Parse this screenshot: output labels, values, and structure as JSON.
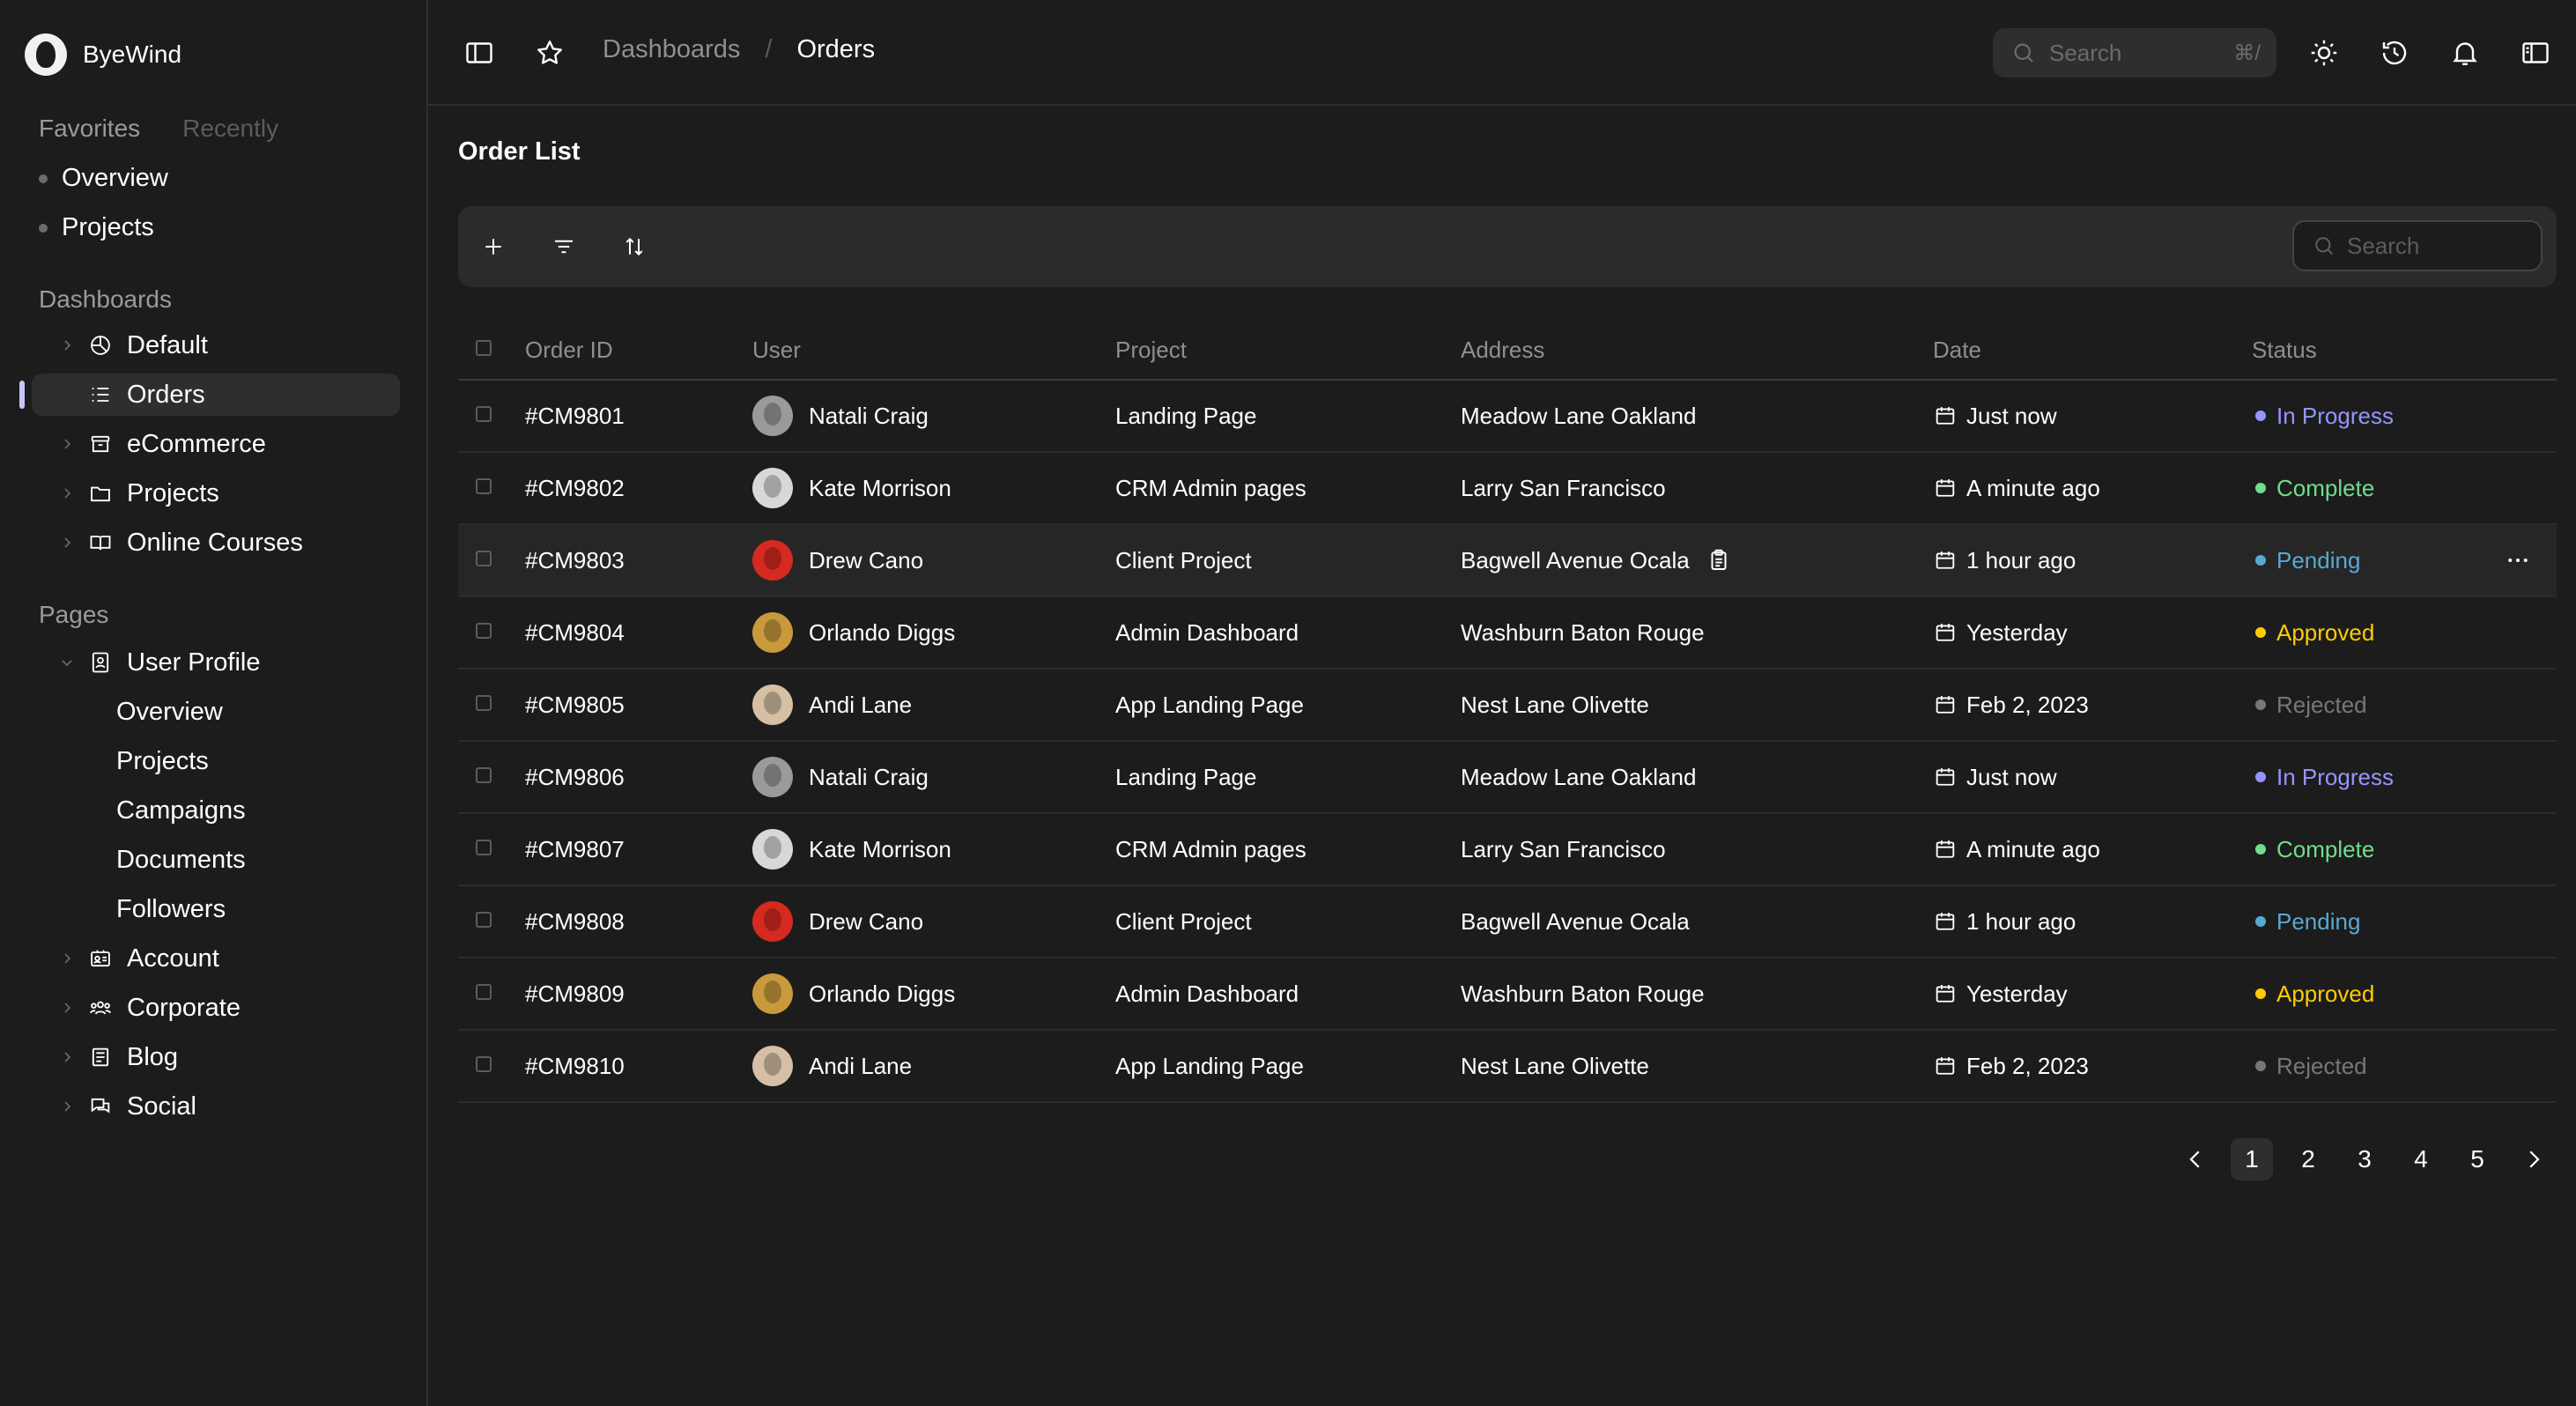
{
  "brand": {
    "name": "ByeWind"
  },
  "favorites": {
    "tabs": [
      "Favorites",
      "Recently"
    ],
    "items": [
      "Overview",
      "Projects"
    ]
  },
  "sidebar": {
    "dashboards_label": "Dashboards",
    "dashboards": [
      {
        "label": "Default",
        "icon": "pie-chart-icon"
      },
      {
        "label": "Orders",
        "icon": "list-icon",
        "active": true
      },
      {
        "label": "eCommerce",
        "icon": "store-icon"
      },
      {
        "label": "Projects",
        "icon": "folder-icon"
      },
      {
        "label": "Online Courses",
        "icon": "book-icon"
      }
    ],
    "pages_label": "Pages",
    "user_profile": {
      "label": "User Profile",
      "icon": "id-card-icon",
      "children": [
        "Overview",
        "Projects",
        "Campaigns",
        "Documents",
        "Followers"
      ]
    },
    "pages": [
      {
        "label": "Account",
        "icon": "account-icon"
      },
      {
        "label": "Corporate",
        "icon": "users-icon"
      },
      {
        "label": "Blog",
        "icon": "notebook-icon"
      },
      {
        "label": "Social",
        "icon": "chat-icon"
      }
    ]
  },
  "topbar": {
    "breadcrumb": [
      "Dashboards",
      "Orders"
    ],
    "breadcrumb_sep": "/",
    "search_placeholder": "Search",
    "search_shortcut": "⌘/"
  },
  "main": {
    "title": "Order List",
    "search_placeholder": "Search",
    "columns": [
      "Order ID",
      "User",
      "Project",
      "Address",
      "Date",
      "Status"
    ]
  },
  "status_colors": {
    "In Progress": "#9595ff",
    "Complete": "#71dd8c",
    "Pending": "#59a8d4",
    "Approved": "#ffcc00",
    "Rejected": "#777777"
  },
  "orders": [
    {
      "id": "#CM9801",
      "user": "Natali Craig",
      "project": "Landing Page",
      "address": "Meadow Lane Oakland",
      "date": "Just now",
      "status": "In Progress",
      "avatar": "#9a9a9a"
    },
    {
      "id": "#CM9802",
      "user": "Kate Morrison",
      "project": "CRM Admin pages",
      "address": "Larry San Francisco",
      "date": "A minute ago",
      "status": "Complete",
      "avatar": "#d8d8d8"
    },
    {
      "id": "#CM9803",
      "user": "Drew Cano",
      "project": "Client Project",
      "address": "Bagwell Avenue Ocala",
      "date": "1 hour ago",
      "status": "Pending",
      "avatar": "#d42a1f"
    },
    {
      "id": "#CM9804",
      "user": "Orlando Diggs",
      "project": "Admin Dashboard",
      "address": "Washburn Baton Rouge",
      "date": "Yesterday",
      "status": "Approved",
      "avatar": "#c89a3c"
    },
    {
      "id": "#CM9805",
      "user": "Andi Lane",
      "project": "App Landing Page",
      "address": "Nest Lane Olivette",
      "date": "Feb 2, 2023",
      "status": "Rejected",
      "avatar": "#d6bfa5"
    },
    {
      "id": "#CM9806",
      "user": "Natali Craig",
      "project": "Landing Page",
      "address": "Meadow Lane Oakland",
      "date": "Just now",
      "status": "In Progress",
      "avatar": "#9a9a9a"
    },
    {
      "id": "#CM9807",
      "user": "Kate Morrison",
      "project": "CRM Admin pages",
      "address": "Larry San Francisco",
      "date": "A minute ago",
      "status": "Complete",
      "avatar": "#d8d8d8"
    },
    {
      "id": "#CM9808",
      "user": "Drew Cano",
      "project": "Client Project",
      "address": "Bagwell Avenue Ocala",
      "date": "1 hour ago",
      "status": "Pending",
      "avatar": "#d42a1f"
    },
    {
      "id": "#CM9809",
      "user": "Orlando Diggs",
      "project": "Admin Dashboard",
      "address": "Washburn Baton Rouge",
      "date": "Yesterday",
      "status": "Approved",
      "avatar": "#c89a3c"
    },
    {
      "id": "#CM9810",
      "user": "Andi Lane",
      "project": "App Landing Page",
      "address": "Nest Lane Olivette",
      "date": "Feb 2, 2023",
      "status": "Rejected",
      "avatar": "#d6bfa5"
    }
  ],
  "pagination": {
    "pages": [
      "1",
      "2",
      "3",
      "4",
      "5"
    ],
    "current": "1"
  }
}
